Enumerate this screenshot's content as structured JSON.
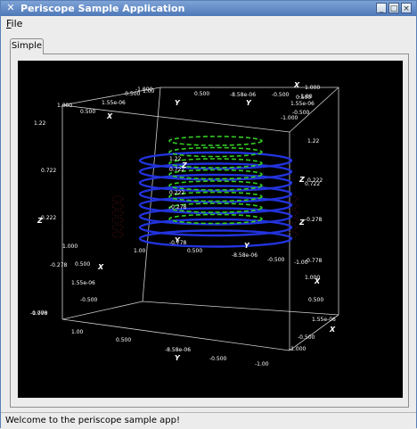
{
  "window": {
    "title": "Periscope Sample Application",
    "app_icon": "x-icon",
    "min_glyph": "_",
    "max_glyph": "□",
    "close_glyph": "×"
  },
  "menubar": {
    "file": "File"
  },
  "tabs": [
    {
      "label": "Simple",
      "selected": true
    }
  ],
  "status": "Welcome to the periscope sample app!",
  "plot": {
    "background": "#000000",
    "axis_names": {
      "x": "X",
      "y": "Y",
      "z": "Z"
    },
    "ticks": {
      "x": [
        "1.000",
        "0.500",
        "1.55e-06",
        "-0.500",
        "-1.000"
      ],
      "y": [
        "1.00",
        "0.500",
        "-8.58e-06",
        "-0.500",
        "-1.00"
      ],
      "z": [
        "1.22",
        "0.722",
        "0.222",
        "-0.278",
        "-0.778"
      ]
    },
    "series": [
      {
        "name": "helix",
        "color": "#2233dd",
        "style": "solid"
      },
      {
        "name": "dashed helix",
        "color": "#33cc22",
        "style": "dashed"
      },
      {
        "name": "faint surface",
        "color": "#5a1414",
        "style": "dotted"
      }
    ]
  }
}
